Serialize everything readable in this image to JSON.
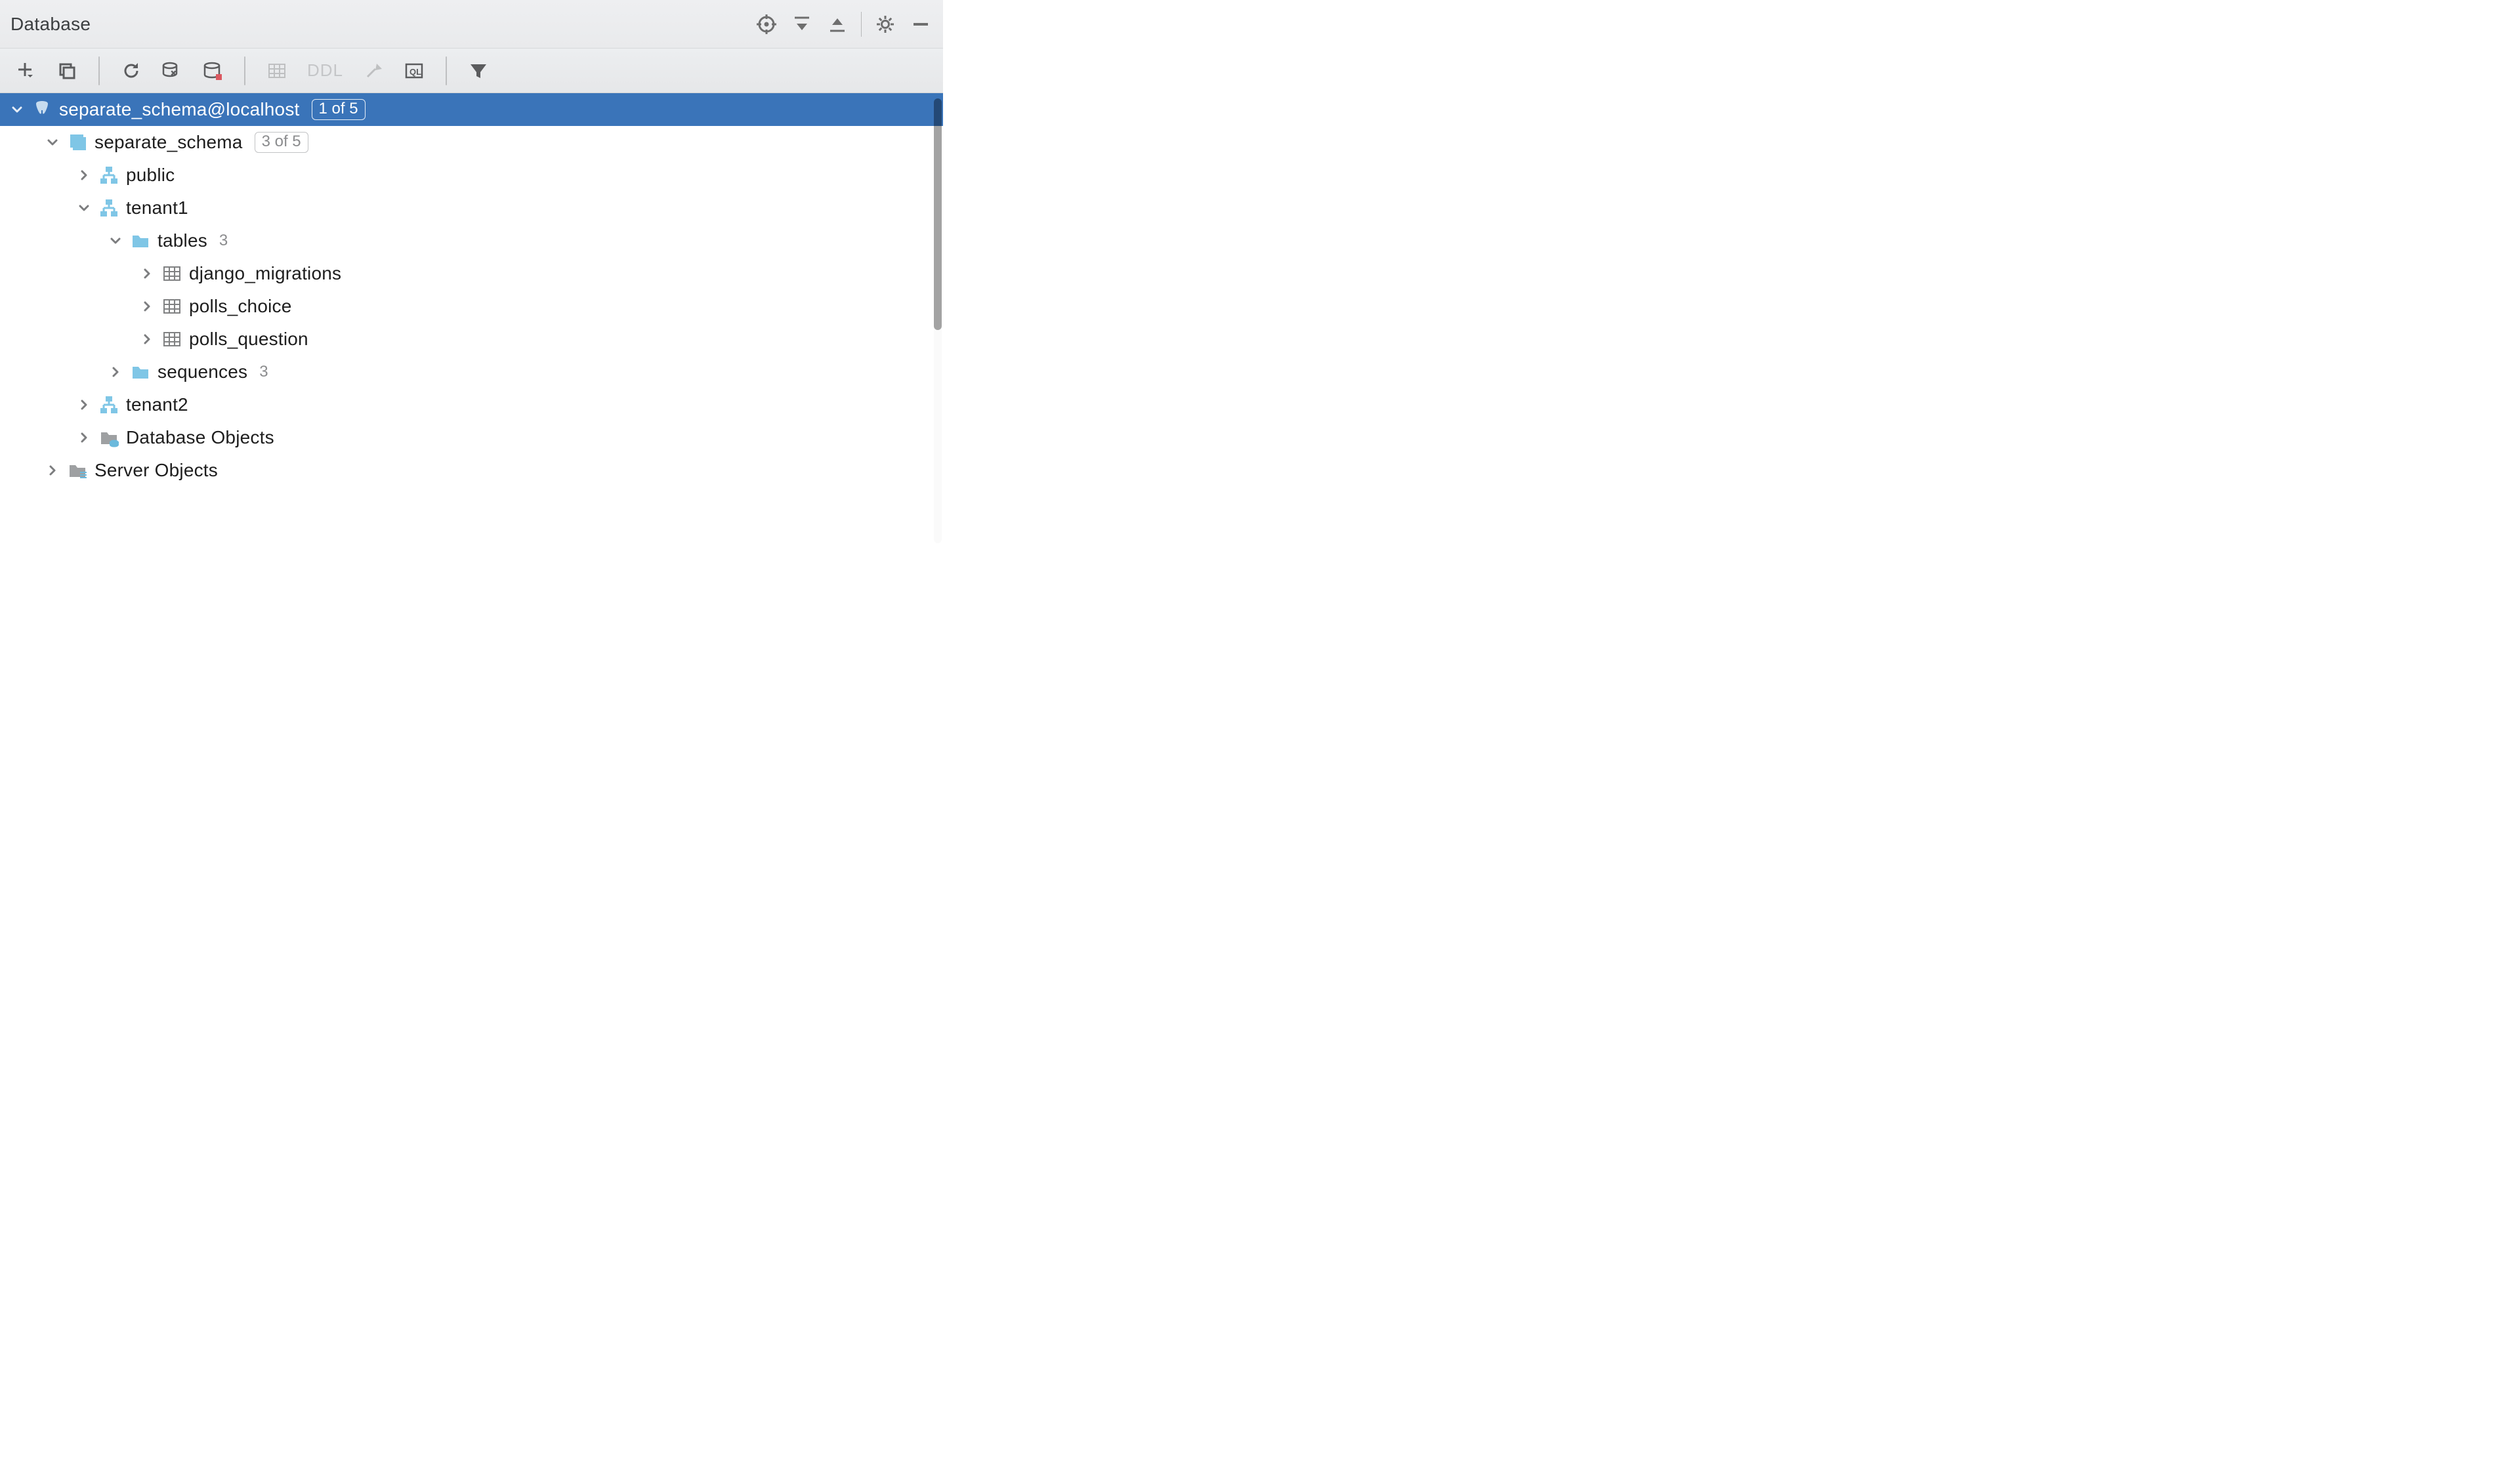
{
  "panel": {
    "title": "Database"
  },
  "toolbar": {
    "ddl_label": "DDL"
  },
  "tree": {
    "datasource": {
      "label": "separate_schema@localhost",
      "badge": "1 of 5"
    },
    "database": {
      "label": "separate_schema",
      "badge": "3 of 5"
    },
    "schema_public": "public",
    "schema_tenant1": "tenant1",
    "tables": {
      "label": "tables",
      "count": "3"
    },
    "table_django_migrations": "django_migrations",
    "table_polls_choice": "polls_choice",
    "table_polls_question": "polls_question",
    "sequences": {
      "label": "sequences",
      "count": "3"
    },
    "schema_tenant2": "tenant2",
    "db_objects": "Database Objects",
    "server_objects": "Server Objects"
  }
}
